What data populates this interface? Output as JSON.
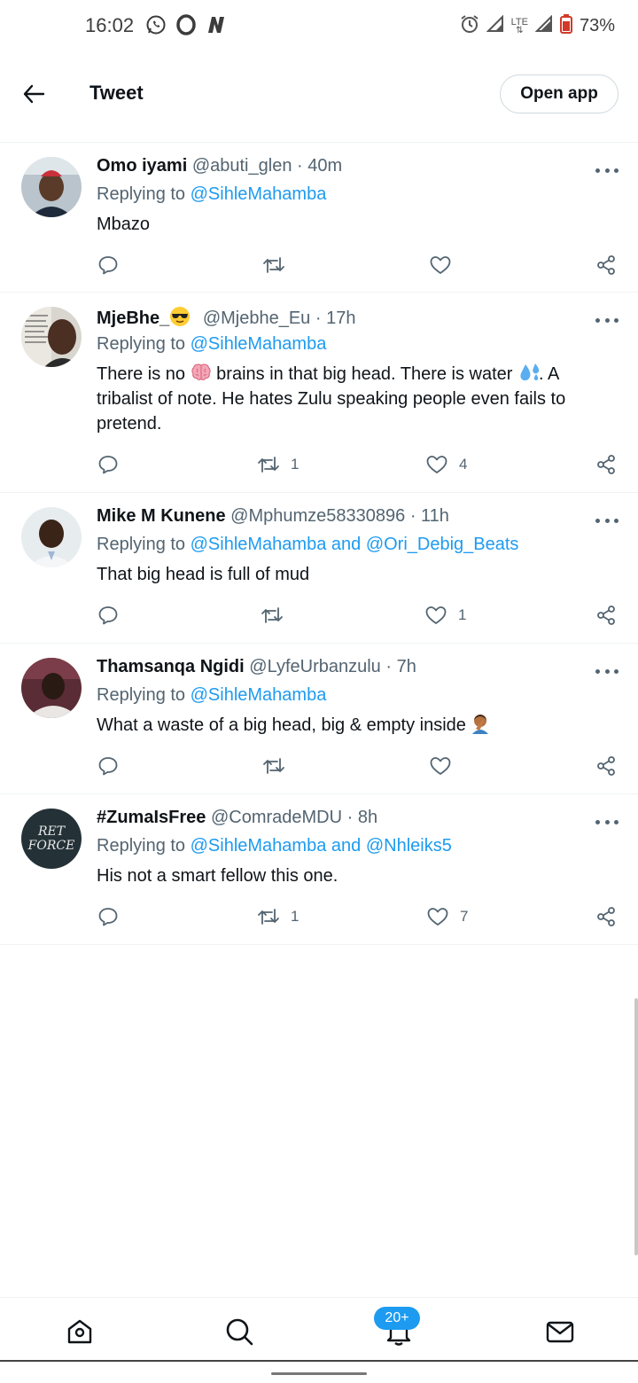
{
  "status_bar": {
    "time": "16:02",
    "app_icons": [
      "whatsapp-icon",
      "opera-icon",
      "news-icon"
    ],
    "system_icons": [
      "alarm-icon",
      "signal-icon",
      "lte-icon",
      "signal-icon",
      "battery-icon"
    ],
    "network_label": "LTE",
    "battery": "73%"
  },
  "header": {
    "title": "Tweet",
    "open_app_label": "Open app"
  },
  "tweets": [
    {
      "name": "Omo iyami",
      "handle": "@abuti_glen",
      "dot": "·",
      "time": "40m",
      "replying_prefix": "Replying to ",
      "replying_to": "@SihleMahamba",
      "body": "Mbazo",
      "retweets": "",
      "likes": ""
    },
    {
      "name": "MjeBhe_",
      "handle": "@Mjebhe_Eu",
      "dot": "·",
      "time": "17h",
      "replying_prefix": "Replying to ",
      "replying_to": "@SihleMahamba",
      "body_part1": "There is no ",
      "body_part2": " brains in that big head. There is water ",
      "body_part3": ". A tribalist of note. He hates Zulu speaking people even fails to pretend.",
      "retweets": "1",
      "likes": "4"
    },
    {
      "name": "Mike M Kunene",
      "handle": "@Mphumze58330896",
      "dot": "·",
      "time": "11h",
      "replying_prefix": "Replying to ",
      "replying_to": "@SihleMahamba and @Ori_Debig_Beats",
      "body": "That big head is full of mud",
      "retweets": "",
      "likes": "1"
    },
    {
      "name": "Thamsanqa Ngidi",
      "handle": "@LyfeUrbanzulu",
      "dot": "·",
      "time": "7h",
      "replying_prefix": "Replying to ",
      "replying_to": "@SihleMahamba",
      "body": "What a waste of a big head, big & empty inside",
      "retweets": "",
      "likes": ""
    },
    {
      "name": "#ZumaIsFree",
      "handle": "@ComradeMDU",
      "dot": "·",
      "time": "8h",
      "replying_prefix": "Replying to ",
      "replying_to": "@SihleMahamba and @Nhleiks5",
      "body": "His not a smart fellow this one.",
      "avatar_text_1": "RET",
      "avatar_text_2": "FORCE",
      "retweets": "1",
      "likes": "7"
    }
  ],
  "bottom_nav": {
    "items": [
      "home-icon",
      "search-icon",
      "notifications-icon",
      "messages-icon"
    ],
    "notifications_badge": "20+"
  },
  "colors": {
    "accent": "#1d9bf0",
    "text_primary": "#0f1419",
    "text_secondary": "#536471",
    "divider": "#eff3f4"
  }
}
